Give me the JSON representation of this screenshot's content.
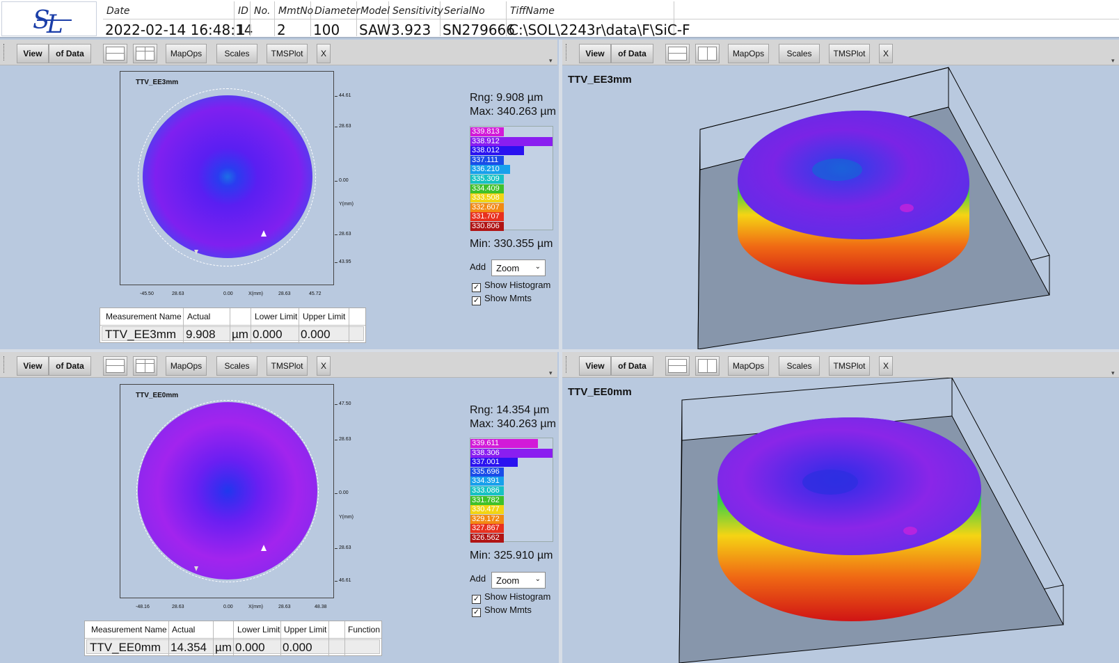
{
  "header": {
    "columns": [
      {
        "label": "Date",
        "value": "2022-02-14 16:48:14"
      },
      {
        "label": "ID",
        "value": "1"
      },
      {
        "label": "No.",
        "value": ""
      },
      {
        "label": "MmtNo",
        "value": "2"
      },
      {
        "label": "Diameter",
        "value": "100"
      },
      {
        "label": "Model",
        "value": "SAW"
      },
      {
        "label": "Sensitivity",
        "value": "3.923"
      },
      {
        "label": "SerialNo",
        "value": "SN279666"
      },
      {
        "label": "TiffName",
        "value": "C:\\SOL\\2243r\\data\\F\\SiC-F"
      }
    ],
    "logo_text": "SL"
  },
  "toolbar": {
    "view": "View",
    "of_data": "of Data",
    "mapops": "MapOps",
    "scales": "Scales",
    "tmsplot": "TMSPlot",
    "close": "X"
  },
  "map_panels": [
    {
      "title": "TTV_EE3mm",
      "y_ticks": [
        "44.61",
        "28.63",
        "0.00",
        "Y(mm)",
        "28.63",
        "43.95"
      ],
      "x_ticks": [
        "-45.50",
        "28.63",
        "0.00",
        "X(mm)",
        "28.63",
        "45.72"
      ],
      "range": "Rng: 9.908 µm",
      "max": "Max: 340.263 µm",
      "min": "Min: 330.355 µm",
      "histogram": [
        {
          "label": "339.813",
          "color": "#d21ad8",
          "fraction": 0.38
        },
        {
          "label": "338.912",
          "color": "#8a1ef0",
          "fraction": 1.0
        },
        {
          "label": "338.012",
          "color": "#2a12f0",
          "fraction": 0.65
        },
        {
          "label": "337.111",
          "color": "#1a4ce8",
          "fraction": 0.4
        },
        {
          "label": "336.210",
          "color": "#17a0ec",
          "fraction": 0.48
        },
        {
          "label": "335.309",
          "color": "#16c2c4",
          "fraction": 0.4
        },
        {
          "label": "334.409",
          "color": "#3fc12b",
          "fraction": 0.35
        },
        {
          "label": "333.508",
          "color": "#f2d414",
          "fraction": 0.38
        },
        {
          "label": "332.607",
          "color": "#f28a14",
          "fraction": 0.33
        },
        {
          "label": "331.707",
          "color": "#e8301e",
          "fraction": 0.33
        },
        {
          "label": "330.806",
          "color": "#b01414",
          "fraction": 0.33
        }
      ],
      "add_label": "Add",
      "add_select": "Zoom",
      "show_histogram": "Show Histogram",
      "show_mmts": "Show Mmts",
      "table": {
        "headers": [
          "Measurement Name",
          "Actual",
          "",
          "Lower Limit",
          "Upper Limit"
        ],
        "row": [
          "TTV_EE3mm",
          "9.908",
          "µm",
          "0.000",
          "0.000"
        ]
      }
    },
    {
      "title": "TTV_EE0mm",
      "y_ticks": [
        "47.50",
        "28.63",
        "0.00",
        "Y(mm)",
        "28.63",
        "46.61"
      ],
      "x_ticks": [
        "-48.16",
        "28.63",
        "0.00",
        "X(mm)",
        "28.63",
        "48.38"
      ],
      "range": "Rng: 14.354 µm",
      "max": "Max: 340.263 µm",
      "min": "Min: 325.910 µm",
      "histogram": [
        {
          "label": "339.611",
          "color": "#d21ad8",
          "fraction": 0.82
        },
        {
          "label": "338.306",
          "color": "#8a1ef0",
          "fraction": 1.0
        },
        {
          "label": "337.001",
          "color": "#2a12f0",
          "fraction": 0.58
        },
        {
          "label": "335.696",
          "color": "#1a4ce8",
          "fraction": 0.4
        },
        {
          "label": "334.391",
          "color": "#17a0ec",
          "fraction": 0.4
        },
        {
          "label": "333.086",
          "color": "#16c2c4",
          "fraction": 0.4
        },
        {
          "label": "331.782",
          "color": "#3fc12b",
          "fraction": 0.4
        },
        {
          "label": "330.477",
          "color": "#f2d414",
          "fraction": 0.4
        },
        {
          "label": "329.172",
          "color": "#f28a14",
          "fraction": 0.35
        },
        {
          "label": "327.867",
          "color": "#e8301e",
          "fraction": 0.35
        },
        {
          "label": "326.562",
          "color": "#b01414",
          "fraction": 0.35
        }
      ],
      "add_label": "Add",
      "add_select": "Zoom",
      "show_histogram": "Show Histogram",
      "show_mmts": "Show Mmts",
      "table": {
        "headers": [
          "Measurement Name",
          "Actual",
          "",
          "Lower Limit",
          "Upper Limit",
          "",
          "Function"
        ],
        "row": [
          "TTV_EE0mm",
          "14.354",
          "µm",
          "0.000",
          "0.000",
          "",
          ""
        ]
      }
    }
  ],
  "view3d_panels": [
    {
      "title": "TTV_EE3mm"
    },
    {
      "title": "TTV_EE0mm"
    }
  ]
}
